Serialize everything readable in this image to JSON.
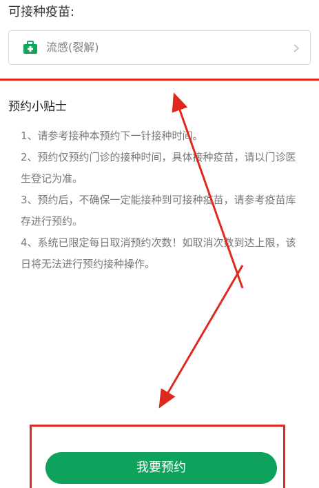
{
  "vaccine_section": {
    "label": "可接种疫苗:",
    "selected_vaccine": "流感(裂解)",
    "icon": "medical-kit-icon",
    "accent_color": "#13a35c"
  },
  "tips": {
    "title": "预约小贴士",
    "items": [
      "1、请参考接种本预约下一针接种时间。",
      "2、预约仅预约门诊的接种时间，具体接种疫苗，请以门诊医生登记为准。",
      "3、预约后，不确保一定能接种到可接种疫苗，请参考疫苗库存进行预约。",
      "4、系统已限定每日取消预约次数！如取消次数到达上限，该日将无法进行预约接种操作。"
    ]
  },
  "action": {
    "book_button_label": "我要预约",
    "button_color": "#0fa25c"
  },
  "annotations": {
    "highlight_color": "#e0291e"
  }
}
